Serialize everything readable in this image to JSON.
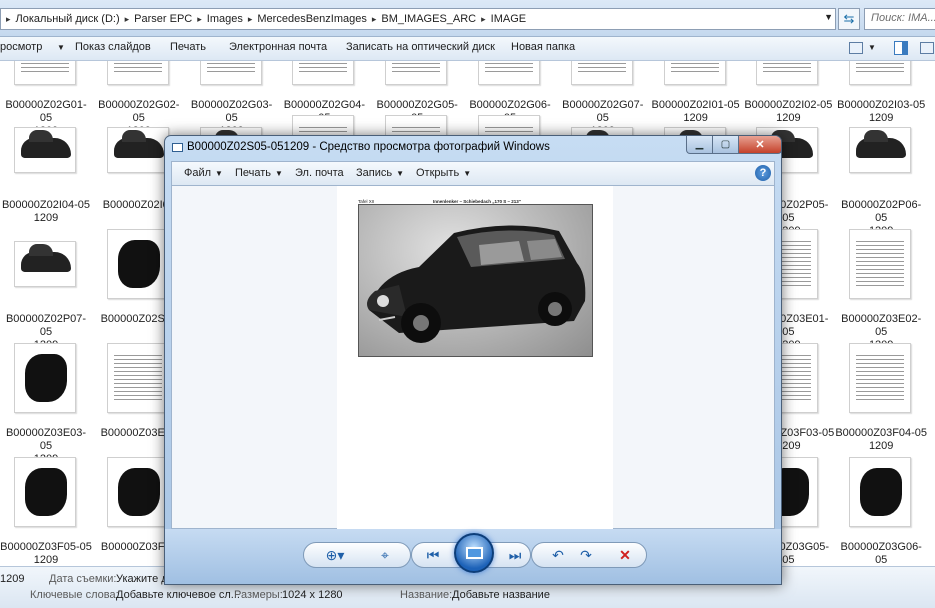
{
  "address": {
    "crumbs": [
      "Локальный диск (D:)",
      "Parser EPC",
      "Images",
      "MercedesBenzImages",
      "BM_IMAGES_ARC",
      "IMAGE"
    ],
    "search_placeholder": "Поиск: IMA..."
  },
  "commands": {
    "view": "росмотр",
    "slideshow": "Показ слайдов",
    "print": "Печать",
    "email": "Электронная почта",
    "burn": "Записать на оптический диск",
    "new_folder": "Новая папка"
  },
  "files": [
    [
      "B00000Z02G01-05",
      "1209",
      "doc"
    ],
    [
      "B00000Z02G02-05",
      "1209",
      "doc"
    ],
    [
      "B00000Z02G03-05",
      "1209",
      "doc"
    ],
    [
      "B00000Z02G04-05",
      "1209",
      "doc"
    ],
    [
      "B00000Z02G05-05",
      "1209",
      "doc"
    ],
    [
      "B00000Z02G06-05",
      "1209",
      "doc"
    ],
    [
      "B00000Z02G07-05",
      "1209",
      "doc"
    ],
    [
      "B00000Z02I01-05",
      "1209",
      "doc"
    ],
    [
      "B00000Z02I02-05",
      "1209",
      "doc"
    ],
    [
      "B00000Z02I03-05",
      "1209",
      "doc"
    ],
    [
      "B00000Z02I04-05",
      "1209",
      "car"
    ],
    [
      "B00000Z02I05",
      "",
      "car"
    ],
    [
      "",
      "",
      "car"
    ],
    [
      "",
      "",
      "doc"
    ],
    [
      "",
      "",
      "doc"
    ],
    [
      "",
      "",
      "doc"
    ],
    [
      "",
      "",
      "car"
    ],
    [
      "",
      "",
      "car"
    ],
    [
      "B00000Z02P05-05",
      "1209",
      "car"
    ],
    [
      "B00000Z02P06-05",
      "1209",
      "car"
    ],
    [
      "B00000Z02P07-05",
      "1209",
      "car"
    ],
    [
      "B00000Z02S01",
      "",
      "engine"
    ],
    [
      "",
      "",
      "doc"
    ],
    [
      "",
      "",
      "doc"
    ],
    [
      "",
      "",
      "doc"
    ],
    [
      "",
      "",
      "doc"
    ],
    [
      "",
      "",
      "doc"
    ],
    [
      "",
      "",
      "doc"
    ],
    [
      "B00000Z03E01-05",
      "1209",
      "doc"
    ],
    [
      "B00000Z03E02-05",
      "1209",
      "doc"
    ],
    [
      "B00000Z03E03-05",
      "1209",
      "engine"
    ],
    [
      "B00000Z03E04",
      "",
      "doc"
    ],
    [
      "",
      "",
      "doc"
    ],
    [
      "",
      "",
      "doc"
    ],
    [
      "",
      "",
      "doc"
    ],
    [
      "",
      "",
      "doc"
    ],
    [
      "",
      "",
      "doc"
    ],
    [
      "",
      "",
      "doc"
    ],
    [
      "B00000Z03F03-05",
      "1209",
      "doc"
    ],
    [
      "B00000Z03F04-05",
      "1209",
      "doc"
    ],
    [
      "B00000Z03F05-05",
      "1209",
      "engine"
    ],
    [
      "B00000Z03F06",
      "",
      "engine"
    ],
    [
      "",
      "",
      "engine"
    ],
    [
      "",
      "",
      "engine"
    ],
    [
      "",
      "",
      "engine"
    ],
    [
      "",
      "",
      "engine"
    ],
    [
      "",
      "",
      "engine"
    ],
    [
      "",
      "",
      "engine"
    ],
    [
      "B00000Z03G05-05",
      "1209",
      "engine"
    ],
    [
      "B00000Z03G06-05",
      "1209",
      "engine"
    ]
  ],
  "details": {
    "left_frag": "1209",
    "date_label": "Дата съемки:",
    "date_value": "Укажите д...",
    "keywords_label": "Ключевые слова:",
    "keywords_value": "Добавьте ключевое сл...",
    "size_label": "Размеры:",
    "size_value": "1024 x 1280",
    "name_label": "Название:",
    "name_value": "Добавьте название"
  },
  "viewer": {
    "title": "B00000Z02S05-051209 - Средство просмотра фотографий Windows",
    "menu": [
      "Файл",
      "Печать",
      "Эл. почта",
      "Запись",
      "Открыть"
    ],
    "help": "?",
    "page_left": "Tafel XII",
    "page_caption": "Innenlenker – Schiebedach „170 S – 213\""
  },
  "icons": {
    "refresh": "refresh-icon",
    "help": "help-icon",
    "zoom": "zoom-icon",
    "fit": "fit-icon",
    "prev": "previous-icon",
    "slideshow": "slideshow-icon",
    "next": "next-icon",
    "rotate_left": "rotate-left-icon",
    "rotate_right": "rotate-right-icon",
    "delete": "delete-icon"
  }
}
